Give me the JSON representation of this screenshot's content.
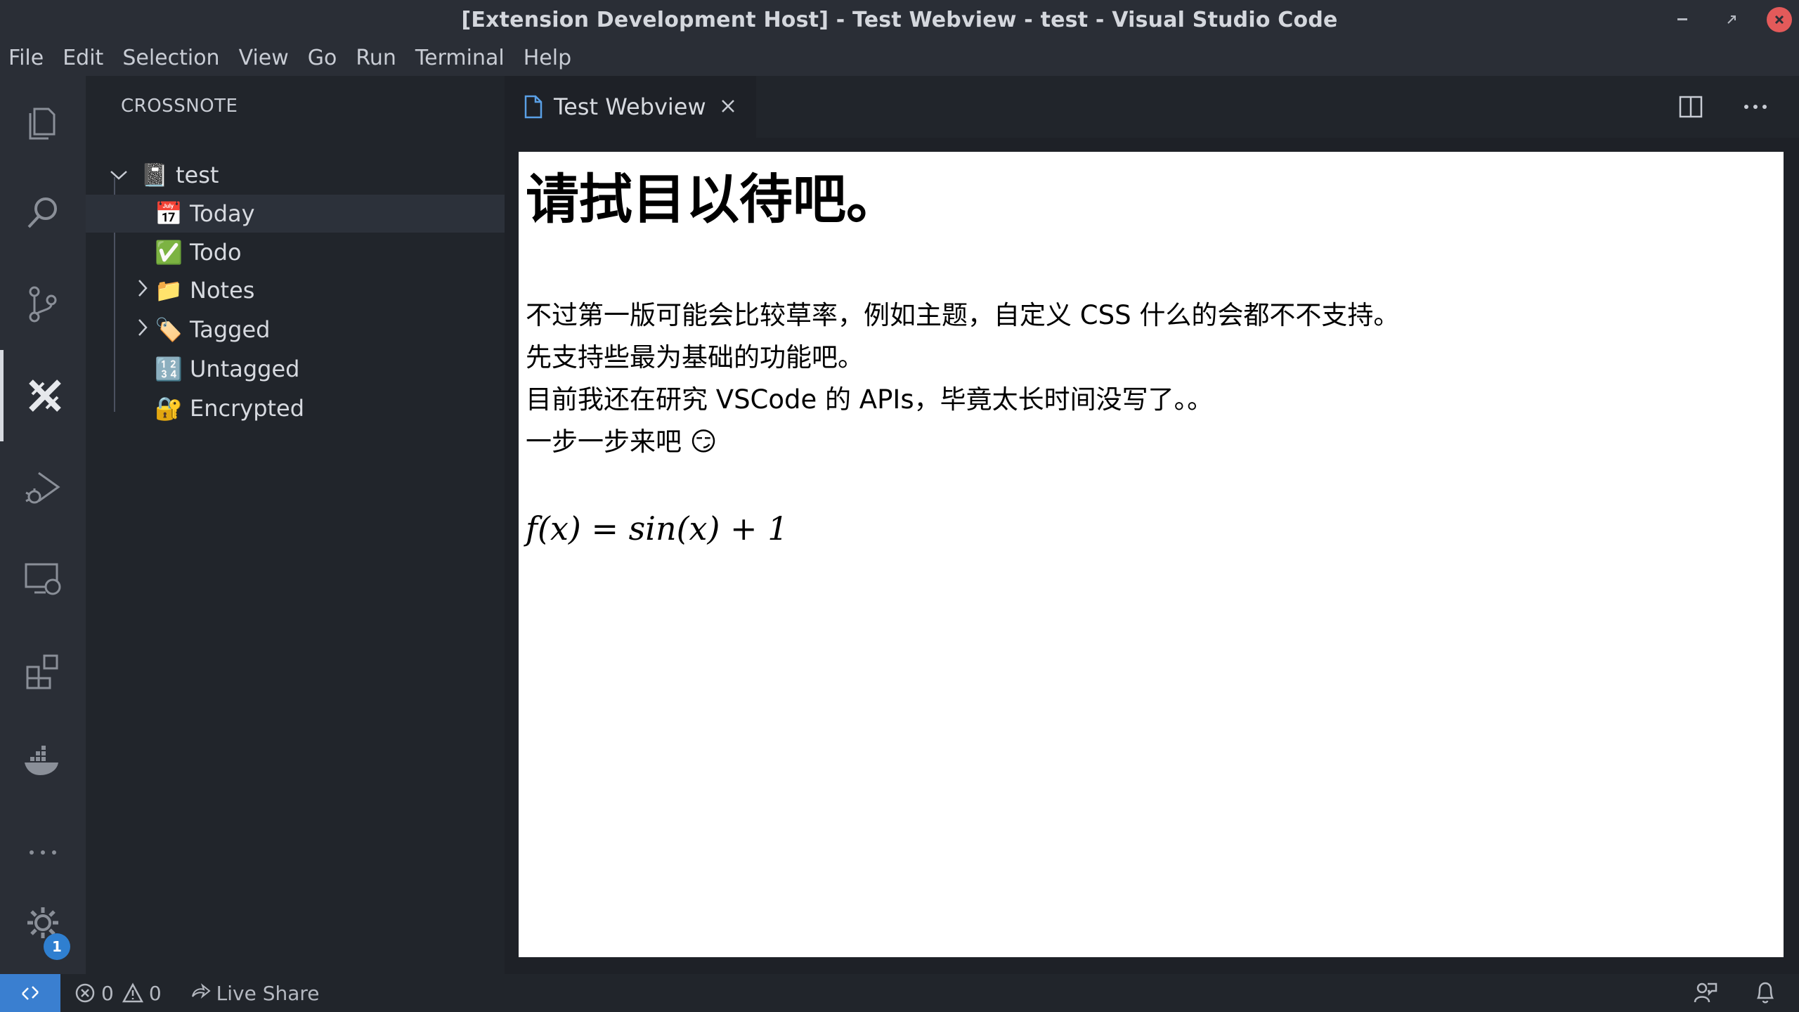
{
  "window": {
    "title": "[Extension Development Host] - Test Webview - test - Visual Studio Code",
    "controls": [
      "minimize",
      "restore",
      "close"
    ]
  },
  "menu": [
    "File",
    "Edit",
    "Selection",
    "View",
    "Go",
    "Run",
    "Terminal",
    "Help"
  ],
  "activity_bar": {
    "items": [
      "explorer-icon",
      "search-icon",
      "source-control-icon",
      "crossnote-icon",
      "run-debug-icon",
      "remote-explorer-icon",
      "extensions-icon",
      "docker-icon",
      "more-icon"
    ],
    "active": "crossnote-icon",
    "settings_badge": "1"
  },
  "sidebar": {
    "header": "CROSSNOTE",
    "root": {
      "label": "test",
      "emoji": "📓"
    },
    "items": [
      {
        "label": "Today",
        "emoji": "📅",
        "expandable": false,
        "selected": true
      },
      {
        "label": "Todo",
        "emoji": "✅",
        "expandable": false
      },
      {
        "label": "Notes",
        "emoji": "📁",
        "expandable": true
      },
      {
        "label": "Tagged",
        "emoji": "🏷️",
        "expandable": true
      },
      {
        "label": "Untagged",
        "emoji": "🔢",
        "expandable": false
      },
      {
        "label": "Encrypted",
        "emoji": "🔐",
        "expandable": false
      }
    ]
  },
  "editor": {
    "tab": {
      "label": "Test Webview"
    },
    "webview": {
      "heading": "请拭目以待吧。",
      "lines": [
        "不过第一版可能会比较草率，例如主题，自定义 CSS 什么的会都不不支持。",
        "先支持些最为基础的功能吧。",
        "目前我还在研究 VSCode 的 APIs，毕竟太长时间没写了。。",
        "一步一步来吧 😏"
      ],
      "formula": "f(x) = sin(x) + 1"
    }
  },
  "status_bar": {
    "errors": "0",
    "warnings": "0",
    "live_share": "Live Share"
  },
  "colors": {
    "background": "#1e2127",
    "sidebar": "#21252b",
    "activity_bar": "#2a2e36",
    "remote_accent": "#3a7fd0",
    "close_button": "#e35a5a"
  }
}
